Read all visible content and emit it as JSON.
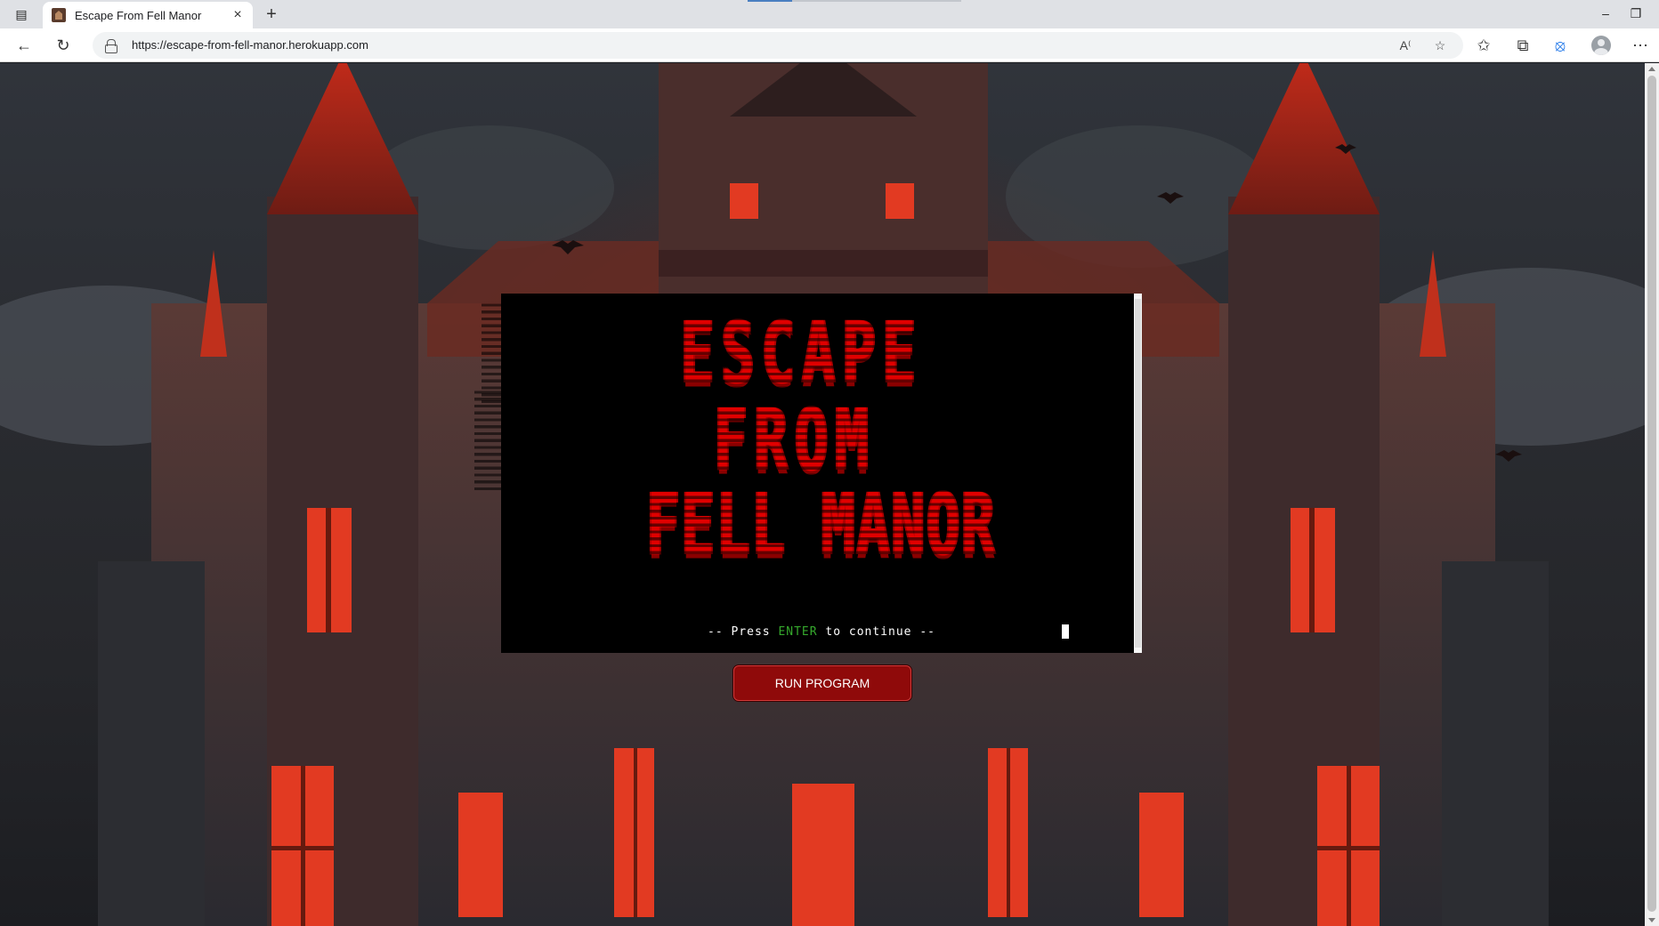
{
  "browser": {
    "tab_title": "Escape From Fell Manor",
    "url": "https://escape-from-fell-manor.herokuapp.com"
  },
  "terminal": {
    "ascii_title_lines": [
      "ESCAPE",
      "FROM",
      "FELL MANOR"
    ],
    "press_prefix": "-- Press ",
    "press_key": "ENTER",
    "press_suffix": " to continue --",
    "title_color": "#e00000",
    "key_color": "#35a82c"
  },
  "run_button": {
    "label": "RUN PROGRAM"
  },
  "colors": {
    "accent": "#8f0a0a",
    "terminal_bg": "#000000"
  }
}
